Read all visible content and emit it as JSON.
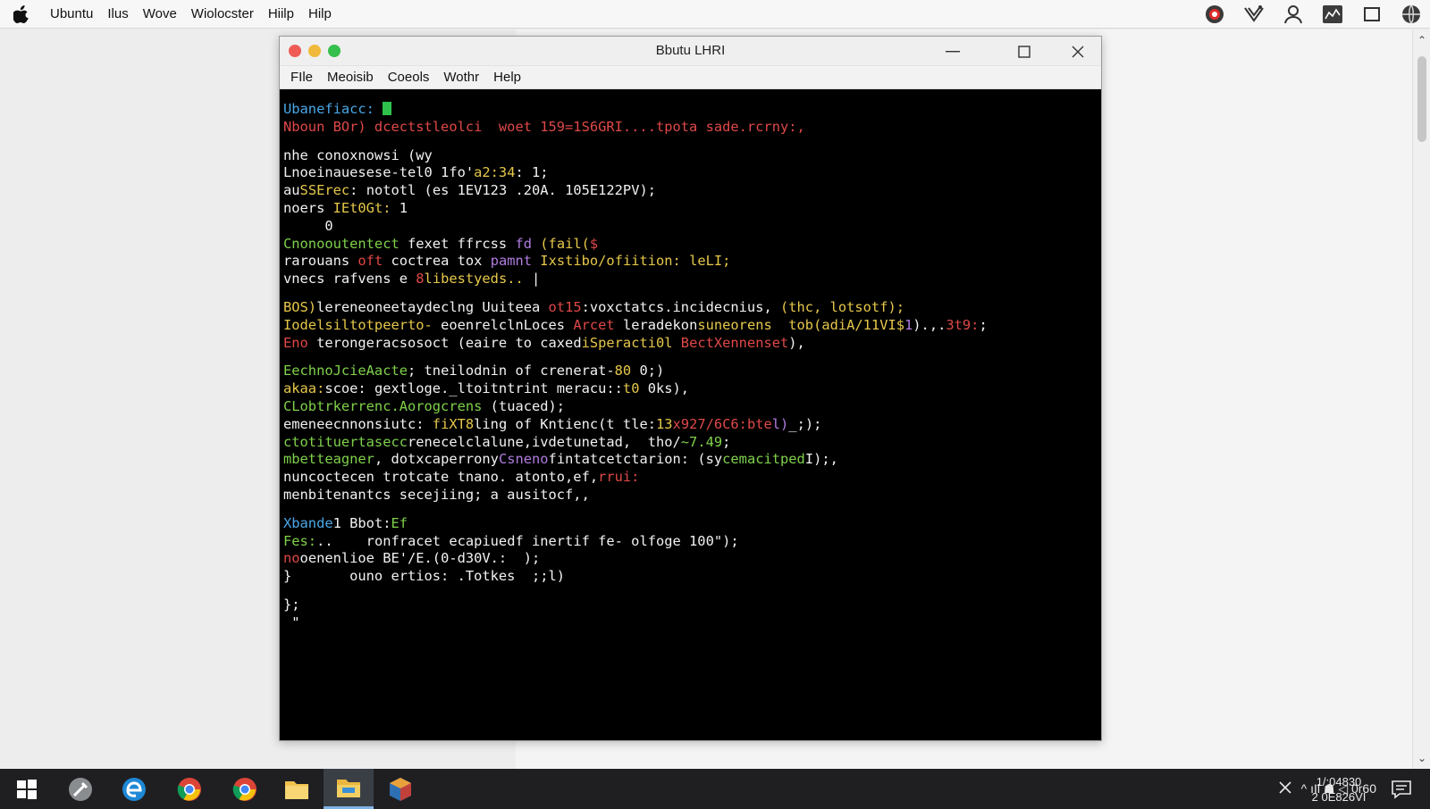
{
  "top_menu": {
    "items": [
      "Ubuntu",
      "Ilus",
      "Wove",
      "Wiolocster",
      "Hiilp",
      "Hilp"
    ]
  },
  "window": {
    "title": "Bbutu LHRI",
    "menu": [
      "FIle",
      "Meoisib",
      "Coeols",
      "Wothr",
      "Help"
    ]
  },
  "terminal": {
    "lines": [
      [
        {
          "t": "Ubanefiacc: ",
          "c": "#4aa8e8"
        }
      ],
      [
        {
          "t": "Nboun BOr) dcectstleolci  woet 159=1S6GRI....tpota sade.rcrny:,",
          "c": "#e04848"
        }
      ],
      [
        {
          "t": "",
          "c": "#ffffff"
        }
      ],
      [
        {
          "t": "nhe conoxnowsi (wy",
          "c": "#f2f2f2"
        }
      ],
      [
        {
          "t": "Lnoeinauesese-tel0 1fo'",
          "c": "#f2f2f2"
        },
        {
          "t": "a2:34",
          "c": "#e6c84a"
        },
        {
          "t": ": 1;",
          "c": "#f2f2f2"
        }
      ],
      [
        {
          "t": "au",
          "c": "#f2f2f2"
        },
        {
          "t": "SSErec",
          "c": "#e6c84a"
        },
        {
          "t": ": nototl (es 1EV123 .20A. 105E122PV);",
          "c": "#f2f2f2"
        }
      ],
      [
        {
          "t": "noers ",
          "c": "#f2f2f2"
        },
        {
          "t": "IEt0Gt:",
          "c": "#e6c84a"
        },
        {
          "t": " 1",
          "c": "#f2f2f2"
        }
      ],
      [
        {
          "t": "     0",
          "c": "#f2f2f2"
        }
      ],
      [
        {
          "t": "Cnonooutentect ",
          "c": "#7fd24a"
        },
        {
          "t": "fexet ffrcss ",
          "c": "#f2f2f2"
        },
        {
          "t": "fd",
          "c": "#b07ce0"
        },
        {
          "t": " (fail(",
          "c": "#e6c84a"
        },
        {
          "t": "$",
          "c": "#e04848"
        }
      ],
      [
        {
          "t": "rarouans ",
          "c": "#f2f2f2"
        },
        {
          "t": "oft",
          "c": "#e04848"
        },
        {
          "t": " coctrea tox ",
          "c": "#f2f2f2"
        },
        {
          "t": "pamnt",
          "c": "#b07ce0"
        },
        {
          "t": " Ixstibo/ofiition: leLI;",
          "c": "#e6c84a"
        }
      ],
      [
        {
          "t": "vnecs rafvens e ",
          "c": "#f2f2f2"
        },
        {
          "t": "8",
          "c": "#e04848"
        },
        {
          "t": "libestyeds..",
          "c": "#e6c84a"
        },
        {
          "t": " |",
          "c": "#f2f2f2"
        }
      ],
      [
        {
          "t": "",
          "c": "#ffffff"
        }
      ],
      [
        {
          "t": "BOS)",
          "c": "#e6c84a"
        },
        {
          "t": "lereneoneetaydeclng Uuiteea ",
          "c": "#f2f2f2"
        },
        {
          "t": "ot15",
          "c": "#e04848"
        },
        {
          "t": ":voxctatcs.incidecnius, ",
          "c": "#f2f2f2"
        },
        {
          "t": "(thc, lotsotf);",
          "c": "#e6c84a"
        }
      ],
      [
        {
          "t": "Iodelsiltotpeerto- ",
          "c": "#e6c84a"
        },
        {
          "t": "eoenrelclnLoces ",
          "c": "#f2f2f2"
        },
        {
          "t": "Arcet ",
          "c": "#e04848"
        },
        {
          "t": "leradekon",
          "c": "#f2f2f2"
        },
        {
          "t": "suneorens  tob(adiA/11VI$",
          "c": "#e6c84a"
        },
        {
          "t": "1",
          "c": "#b07ce0"
        },
        {
          "t": ").,.",
          "c": "#f2f2f2"
        },
        {
          "t": "3t9:",
          "c": "#e04848"
        },
        {
          "t": ";",
          "c": "#f2f2f2"
        }
      ],
      [
        {
          "t": "Eno ",
          "c": "#e04848"
        },
        {
          "t": "terongeracsosoct (eaire to caxed",
          "c": "#f2f2f2"
        },
        {
          "t": "iSperacti0l ",
          "c": "#e6c84a"
        },
        {
          "t": "BectXennenset",
          "c": "#e04848"
        },
        {
          "t": "),",
          "c": "#f2f2f2"
        }
      ],
      [
        {
          "t": "",
          "c": "#ffffff"
        }
      ],
      [
        {
          "t": "EechnoJcieAacte",
          "c": "#7fd24a"
        },
        {
          "t": "; tneilodnin of crenerat-",
          "c": "#f2f2f2"
        },
        {
          "t": "80",
          "c": "#e6c84a"
        },
        {
          "t": " 0;)",
          "c": "#f2f2f2"
        }
      ],
      [
        {
          "t": "akaa:",
          "c": "#e6c84a"
        },
        {
          "t": "scoe: gextloge._ltoitntrint meracu::",
          "c": "#f2f2f2"
        },
        {
          "t": "t0",
          "c": "#e6c84a"
        },
        {
          "t": " 0ks),",
          "c": "#f2f2f2"
        }
      ],
      [
        {
          "t": "CLobtrkerrenc.Aorogcrens ",
          "c": "#7fd24a"
        },
        {
          "t": "(tuaced);",
          "c": "#f2f2f2"
        }
      ],
      [
        {
          "t": "emeneecnnonsiutc: ",
          "c": "#f2f2f2"
        },
        {
          "t": "fiXT8",
          "c": "#e6c84a"
        },
        {
          "t": "ling of Kntienc(t tle:",
          "c": "#f2f2f2"
        },
        {
          "t": "13",
          "c": "#e6c84a"
        },
        {
          "t": "x927/6C6:bte",
          "c": "#e04848"
        },
        {
          "t": "l)",
          "c": "#b07ce0"
        },
        {
          "t": "_;);",
          "c": "#f2f2f2"
        }
      ],
      [
        {
          "t": "ctotituertasecc",
          "c": "#7fd24a"
        },
        {
          "t": "renecelclalune,ivdetunetad,  tho/",
          "c": "#f2f2f2"
        },
        {
          "t": "~7.49",
          "c": "#7fd24a"
        },
        {
          "t": ";",
          "c": "#f2f2f2"
        }
      ],
      [
        {
          "t": "mbetteagner",
          "c": "#7fd24a"
        },
        {
          "t": ", dotxcaperrony",
          "c": "#f2f2f2"
        },
        {
          "t": "Csneno",
          "c": "#b07ce0"
        },
        {
          "t": "fintatcetctarion: (sy",
          "c": "#f2f2f2"
        },
        {
          "t": "cemacitped",
          "c": "#7fd24a"
        },
        {
          "t": "I);,",
          "c": "#f2f2f2"
        }
      ],
      [
        {
          "t": "nuncoctecen trotcate tnano. atonto,ef,",
          "c": "#f2f2f2"
        },
        {
          "t": "rrui:",
          "c": "#e04848"
        }
      ],
      [
        {
          "t": "menbitenantcs secejiing; a ausitocf,,",
          "c": "#f2f2f2"
        }
      ],
      [
        {
          "t": "",
          "c": "#ffffff"
        }
      ],
      [
        {
          "t": "Xbande",
          "c": "#4aa8e8"
        },
        {
          "t": "1 Bbot:",
          "c": "#f2f2f2"
        },
        {
          "t": "Ef",
          "c": "#7fd24a"
        }
      ],
      [
        {
          "t": "Fes:",
          "c": "#7fd24a"
        },
        {
          "t": "..    ronfracet ecapiuedf inertif fe- olfoge 100\");",
          "c": "#f2f2f2"
        }
      ],
      [
        {
          "t": "no",
          "c": "#e04848"
        },
        {
          "t": "oenenlioe BE'/E.(0-d30V.:  );",
          "c": "#f2f2f2"
        }
      ],
      [
        {
          "t": "}       ouno ertios: .Totkes  ;;l)",
          "c": "#f2f2f2"
        }
      ],
      [
        {
          "t": "",
          "c": "#ffffff"
        }
      ],
      [
        {
          "t": "};",
          "c": "#f2f2f2"
        }
      ],
      [
        {
          "t": " \"",
          "c": "#f2f2f2"
        }
      ]
    ]
  },
  "taskbar": {
    "apps": [
      "start",
      "tool",
      "edge",
      "chrome",
      "chrome",
      "folder",
      "file-explorer",
      "cube-app"
    ],
    "active_index": 6,
    "tray": {
      "icons_text": "^ ıIl ☗ ◁ 0r60",
      "clock_time": "1/:04830",
      "clock_date": "2 0E826VI"
    }
  },
  "colors": {
    "terminal_bg": "#000000",
    "taskbar_bg": "#1f1f22",
    "red": "#e04848",
    "yellow": "#e6c84a",
    "green": "#7fd24a",
    "blue": "#4aa8e8",
    "purple": "#b07ce0"
  }
}
